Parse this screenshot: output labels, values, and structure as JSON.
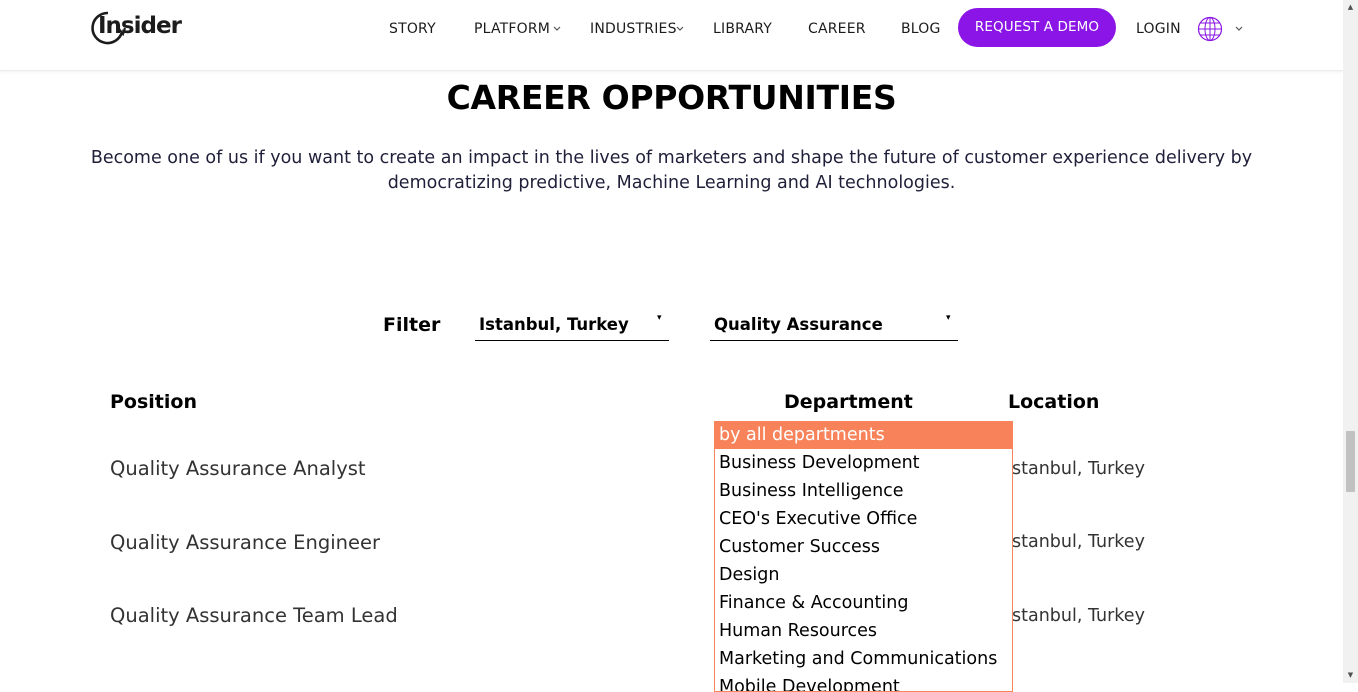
{
  "header": {
    "logo_text": "Insider",
    "nav": [
      "STORY",
      "PLATFORM",
      "INDUSTRIES",
      "LIBRARY",
      "CAREER",
      "BLOG"
    ],
    "demo_button": "REQUEST A DEMO",
    "login": "LOGIN",
    "accent_color": "#8b14e6"
  },
  "hero": {
    "title": "CAREER OPPORTUNITIES",
    "subtitle": "Become one of us if you want to create an impact in the lives of marketers and shape the future of customer experience delivery by democratizing predictive, Machine Learning and AI technologies."
  },
  "filter": {
    "label": "Filter",
    "location_value": "Istanbul, Turkey",
    "department_value": "Quality Assurance"
  },
  "table": {
    "headers": {
      "position": "Position",
      "department": "Department",
      "location": "Location"
    },
    "rows": [
      {
        "position": "Quality Assurance Analyst",
        "location": "stanbul, Turkey"
      },
      {
        "position": "Quality Assurance Engineer",
        "location": "stanbul, Turkey"
      },
      {
        "position": "Quality Assurance Team Lead",
        "location": "stanbul, Turkey"
      }
    ]
  },
  "department_dropdown": {
    "highlight_color": "#f8825a",
    "options": [
      "by all departments",
      "Business Development",
      "Business Intelligence",
      "CEO's Executive Office",
      "Customer Success",
      "Design",
      "Finance & Accounting",
      "Human Resources",
      "Marketing and Communications",
      "Mobile Development"
    ],
    "selected_index": 0
  },
  "icons": {
    "dropdown_arrow": "▾",
    "nav_chevron": "chevron-down-icon",
    "globe": "globe-icon"
  }
}
